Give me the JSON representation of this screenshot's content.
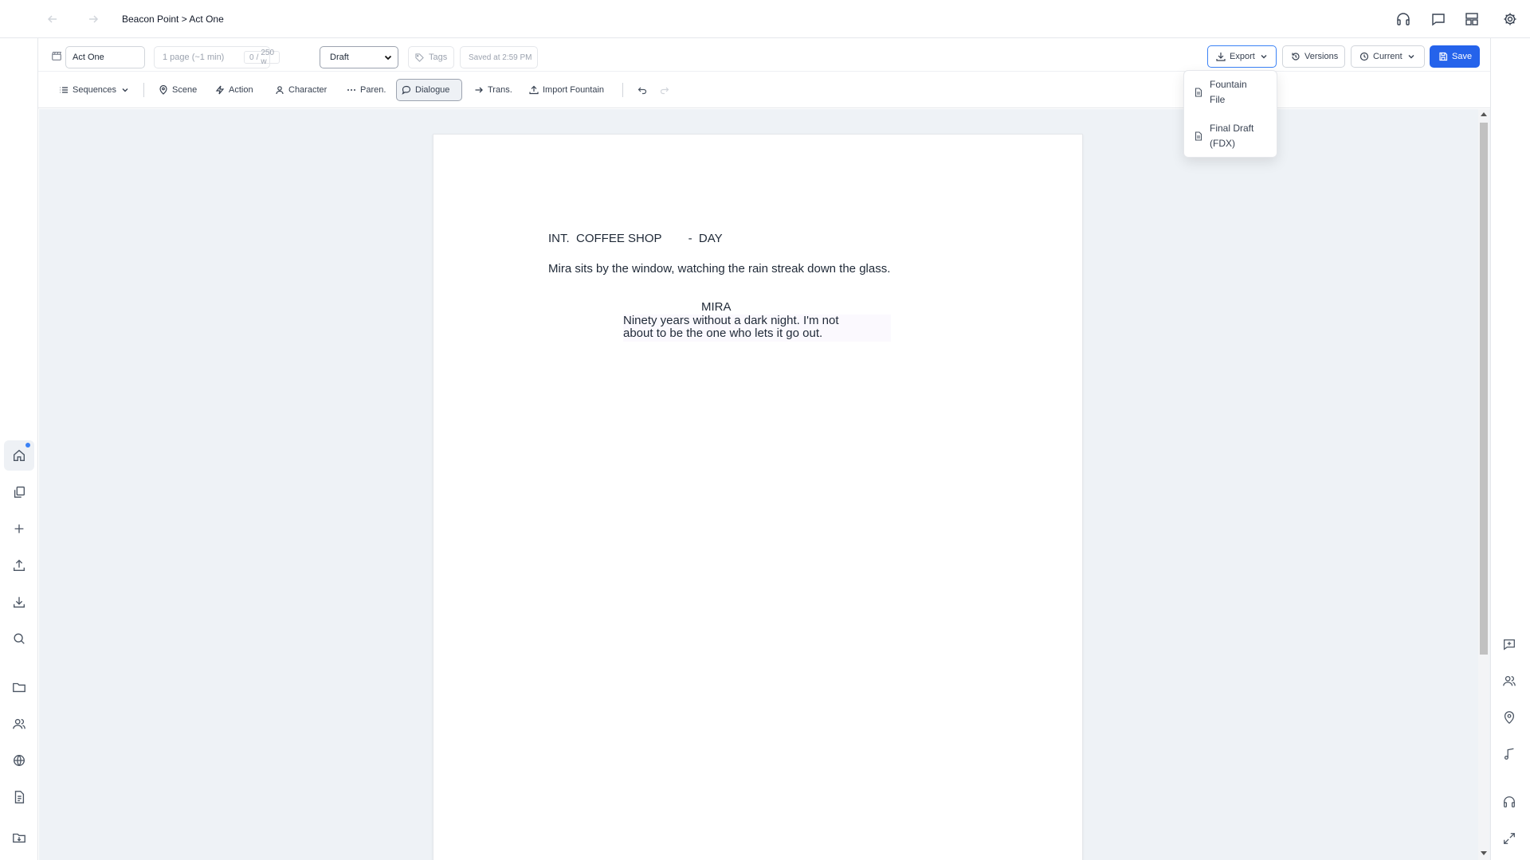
{
  "breadcrumb": {
    "project": "Beacon Point",
    "separator": ">",
    "current": "Act One"
  },
  "toolbar": {
    "scene_name": "Act One",
    "page_estimate": "1 page (~1 min)",
    "word_count": "0",
    "word_goal": "250 w",
    "status": {
      "selected": "Draft",
      "color": "#4a90e2"
    },
    "tags_placeholder": "Tags",
    "saved_text": "Saved at 2:59 PM",
    "export_label": "Export",
    "versions_label": "Versions",
    "current_label": "Current",
    "save_label": "Save"
  },
  "elements_bar": {
    "sequences": "Sequences",
    "scene": "Scene",
    "action": "Action",
    "character": "Character",
    "paren": "Paren.",
    "dialogue": "Dialogue",
    "trans": "Trans.",
    "import": "Import Fountain"
  },
  "export_menu": [
    {
      "line1": "Fountain",
      "line2": "File",
      "icon": "file-icon"
    },
    {
      "line1": "Final Draft",
      "line2": "(FDX)",
      "icon": "file-icon"
    }
  ],
  "script": {
    "scene_heading": "INT.  COFFEE SHOP        -  DAY",
    "action": "Mira sits by the window, watching the rain streak down the glass.",
    "character": "MIRA",
    "dialogue_line1": "Ninety years without a dark night. I'm not",
    "dialogue_line2": "about to be the one who lets it go out."
  },
  "colors": {
    "accent": "#2563eb",
    "canvas": "#eef2f6"
  }
}
